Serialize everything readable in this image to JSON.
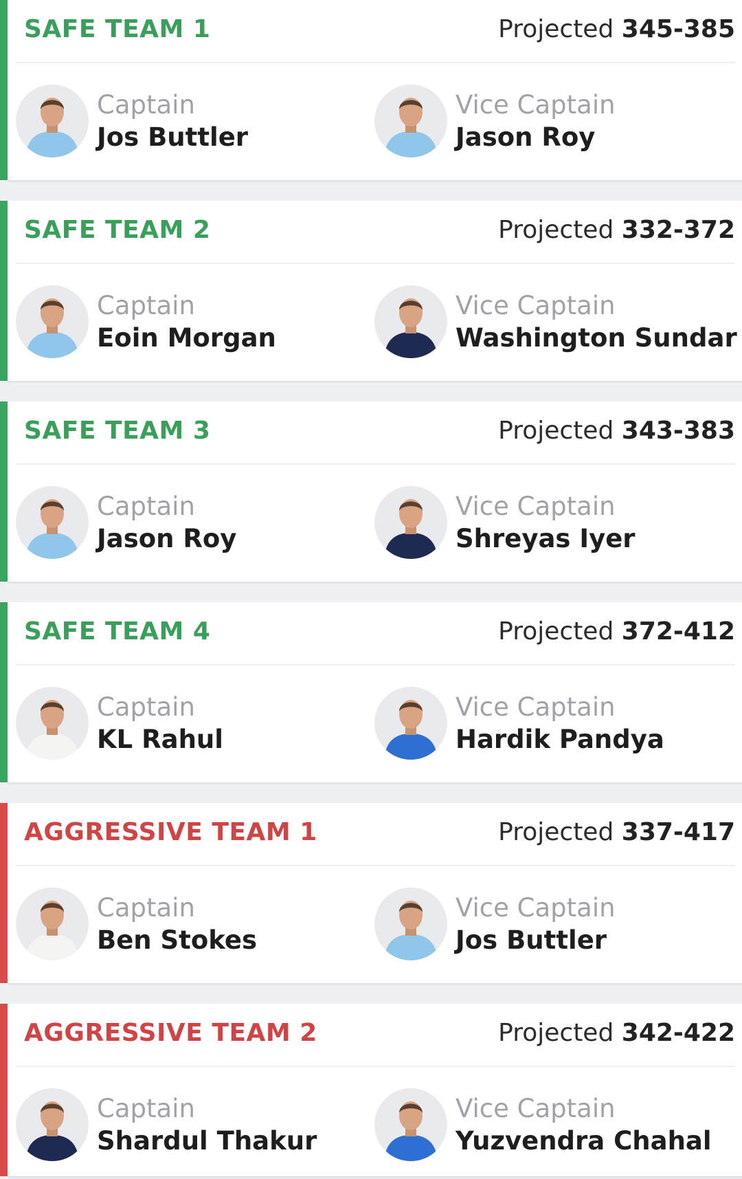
{
  "projected_label": "Projected",
  "teams": [
    {
      "title": "SAFE TEAM 1",
      "range": "345-385",
      "captain": {
        "role": "Captain",
        "name": "Jos Buttler",
        "kit": "england-light"
      },
      "vice_captain": {
        "role": "Vice Captain",
        "name": "Jason Roy",
        "kit": "england-light"
      }
    },
    {
      "title": "SAFE TEAM 2",
      "range": "332-372",
      "captain": {
        "role": "Captain",
        "name": "Eoin Morgan",
        "kit": "england-light"
      },
      "vice_captain": {
        "role": "Vice Captain",
        "name": "Washington Sundar",
        "kit": "india-navy"
      }
    },
    {
      "title": "SAFE TEAM 3",
      "range": "343-383",
      "captain": {
        "role": "Captain",
        "name": "Jason Roy",
        "kit": "england-light"
      },
      "vice_captain": {
        "role": "Vice Captain",
        "name": "Shreyas Iyer",
        "kit": "india-navy"
      }
    },
    {
      "title": "SAFE TEAM 4",
      "range": "372-412",
      "captain": {
        "role": "Captain",
        "name": "KL Rahul",
        "kit": "test-white"
      },
      "vice_captain": {
        "role": "Vice Captain",
        "name": "Hardik Pandya",
        "kit": "india-blue"
      }
    },
    {
      "title": "AGGRESSIVE TEAM 1",
      "range": "337-417",
      "captain": {
        "role": "Captain",
        "name": "Ben Stokes",
        "kit": "test-white"
      },
      "vice_captain": {
        "role": "Vice Captain",
        "name": "Jos Buttler",
        "kit": "england-light"
      }
    },
    {
      "title": "AGGRESSIVE TEAM 2",
      "range": "342-422",
      "captain": {
        "role": "Captain",
        "name": "Shardul Thakur",
        "kit": "india-navy"
      },
      "vice_captain": {
        "role": "Vice Captain",
        "name": "Yuzvendra Chahal",
        "kit": "india-blue"
      }
    }
  ],
  "colors": {
    "safe_accent": "#3aa55d",
    "aggressive_accent": "#d94a4a",
    "role_text": "#9fa3a9",
    "name_text": "#1e1e1e"
  },
  "kits": {
    "england-light": "#8fc6ea",
    "india-navy": "#1f2a52",
    "india-blue": "#2e6fd1",
    "test-white": "#f4f4f2"
  }
}
